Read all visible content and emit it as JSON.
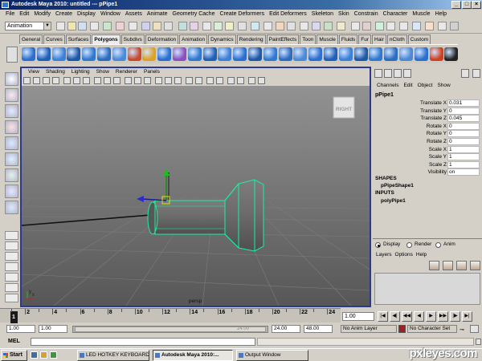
{
  "window": {
    "title": "Autodesk Maya 2010: untitled   ---   pPipe1",
    "min": "_",
    "max": "□",
    "close": "×"
  },
  "menubar": [
    "File",
    "Edit",
    "Modify",
    "Create",
    "Display",
    "Window",
    "Assets",
    "Animate",
    "Geometry Cache",
    "Create Deformers",
    "Edit Deformers",
    "Skeleton",
    "Skin",
    "Constrain",
    "Character",
    "Muscle",
    "Help"
  ],
  "status_line": {
    "mode": "Animation"
  },
  "shelf_tabs": [
    "General",
    "Curves",
    "Surfaces",
    "Polygons",
    "Subdivs",
    "Deformation",
    "Animation",
    "Dynamics",
    "Rendering",
    "PaintEffects",
    "Toon",
    "Muscle",
    "Fluids",
    "Fur",
    "Hair",
    "nCloth",
    "Custom"
  ],
  "active_shelf_tab": "Polygons",
  "panel": {
    "menus": [
      "View",
      "Shading",
      "Lighting",
      "Show",
      "Renderer",
      "Panels"
    ],
    "camera_label": "persp",
    "viewcube_label": "RIGHT",
    "axis_x": "x",
    "axis_y": "y",
    "colors": {
      "viewport_top": "#8e8e8e",
      "viewport_bottom": "#5a5a5a",
      "grid": "#7a7a7a",
      "selection": "#18f0a0"
    }
  },
  "channel_box": {
    "menus": [
      "Channels",
      "Edit",
      "Object",
      "Show"
    ],
    "object": "pPipe1",
    "attributes": [
      {
        "label": "Translate X",
        "value": "0.031"
      },
      {
        "label": "Translate Y",
        "value": "0"
      },
      {
        "label": "Translate Z",
        "value": "0.045"
      },
      {
        "label": "Rotate X",
        "value": "0"
      },
      {
        "label": "Rotate Y",
        "value": "0"
      },
      {
        "label": "Rotate Z",
        "value": "0"
      },
      {
        "label": "Scale X",
        "value": "1"
      },
      {
        "label": "Scale Y",
        "value": "1"
      },
      {
        "label": "Scale Z",
        "value": "1"
      },
      {
        "label": "Visibility",
        "value": "on"
      }
    ],
    "shapes_header": "SHAPES",
    "shape": "pPipeShape1",
    "inputs_header": "INPUTS",
    "input": "polyPipe1"
  },
  "layer_editor": {
    "modes": [
      "Display",
      "Render",
      "Anim"
    ],
    "selected_mode": "Display",
    "menus": [
      "Layers",
      "Options",
      "Help"
    ]
  },
  "time_slider": {
    "ticks": [
      "2",
      "4",
      "6",
      "8",
      "10",
      "12",
      "14",
      "16",
      "18",
      "20",
      "22",
      "24"
    ],
    "current_frame_label": "1",
    "current_frame_field": "1.00"
  },
  "range_slider": {
    "start_time": "1.00",
    "playback_start": "1.00",
    "handle_label": "24.00",
    "playback_end": "24.00",
    "end_time": "48.00",
    "anim_layer": "No Anim Layer",
    "character_set": "No Character Set"
  },
  "command_line": {
    "label": "MEL"
  },
  "taskbar": {
    "start": "Start",
    "tasks": [
      "LED HOTKEY KEYBOARD",
      "Autodesk Maya 2010:...",
      "Output Window"
    ],
    "active_task": "Autodesk Maya 2010:..."
  },
  "watermark": "pxleyes.com"
}
